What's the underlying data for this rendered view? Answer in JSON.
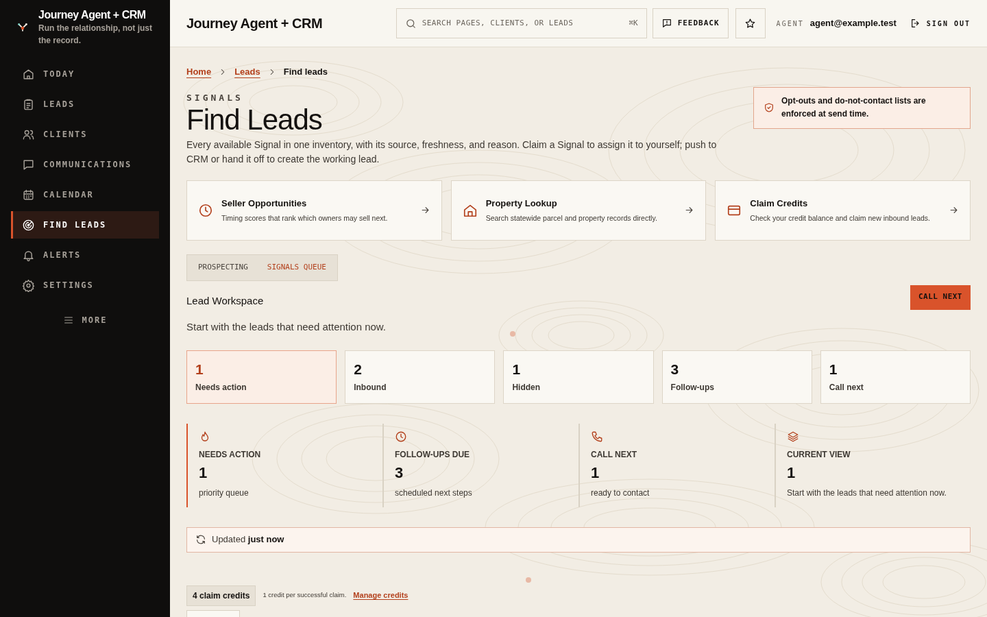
{
  "brand": {
    "title": "Journey Agent + CRM",
    "tagline": "Run the relationship, not just the record."
  },
  "nav": [
    {
      "label": "TODAY",
      "selected": false
    },
    {
      "label": "LEADS",
      "selected": false
    },
    {
      "label": "CLIENTS",
      "selected": false
    },
    {
      "label": "COMMUNICATIONS",
      "selected": false
    },
    {
      "label": "CALENDAR",
      "selected": false
    },
    {
      "label": "FIND LEADS",
      "selected": true
    },
    {
      "label": "ALERTS",
      "selected": false
    },
    {
      "label": "SETTINGS",
      "selected": false
    }
  ],
  "more": {
    "label": "MORE"
  },
  "header": {
    "title": "Journey Agent + CRM",
    "search": {
      "placeholder": "SEARCH PAGES, CLIENTS, OR LEADS",
      "shortcut": "⌘K"
    },
    "feedback": "FEEDBACK",
    "agent_label": "AGENT",
    "agent_email": "agent@example.test",
    "sign_out": "SIGN OUT"
  },
  "breadcrumbs": [
    {
      "label": "Home",
      "link": true
    },
    {
      "label": "Leads",
      "link": true
    },
    {
      "label": "Find leads",
      "link": false
    }
  ],
  "eyebrow": "SIGNALS",
  "title": "Find Leads",
  "intro": "Every available Signal in one inventory, with its source, freshness, and reason. Claim a Signal to assign it to yourself; push to CRM or hand it off to create the working lead.",
  "notice": "Opt-outs and do-not-contact lists are enforced at send time.",
  "tools": [
    {
      "title": "Seller Opportunities",
      "description": "Timing scores that rank which owners may sell next."
    },
    {
      "title": "Property Lookup",
      "description": "Search statewide parcel and property records directly."
    },
    {
      "title": "Claim Credits",
      "description": "Check your credit balance and claim new inbound leads."
    }
  ],
  "tabs": [
    {
      "label": "PROSPECTING",
      "selected": false
    },
    {
      "label": "SIGNALS QUEUE",
      "selected": true
    }
  ],
  "workspace": {
    "title": "Lead Workspace",
    "subtitle": "Start with the leads that need attention now.",
    "action": "CALL NEXT"
  },
  "stats": [
    {
      "value": "1",
      "label": "Needs action",
      "selected": true
    },
    {
      "value": "2",
      "label": "Inbound",
      "selected": false
    },
    {
      "value": "1",
      "label": "Hidden",
      "selected": false
    },
    {
      "value": "3",
      "label": "Follow-ups",
      "selected": false
    },
    {
      "value": "1",
      "label": "Call next",
      "selected": false
    }
  ],
  "metrics": [
    {
      "title": "NEEDS ACTION",
      "value": "1",
      "note": "priority queue",
      "selected": true
    },
    {
      "title": "FOLLOW-UPS DUE",
      "value": "3",
      "note": "scheduled next steps",
      "selected": false
    },
    {
      "title": "CALL NEXT",
      "value": "1",
      "note": "ready to contact",
      "selected": false
    },
    {
      "title": "CURRENT VIEW",
      "value": "1",
      "note": "Start with the leads that need attention now.",
      "selected": false
    }
  ],
  "updated": "Updated **just now**",
  "credits": {
    "count": "4 claim credits",
    "note": "1 credit per successful claim.",
    "link": "Manage credits"
  }
}
